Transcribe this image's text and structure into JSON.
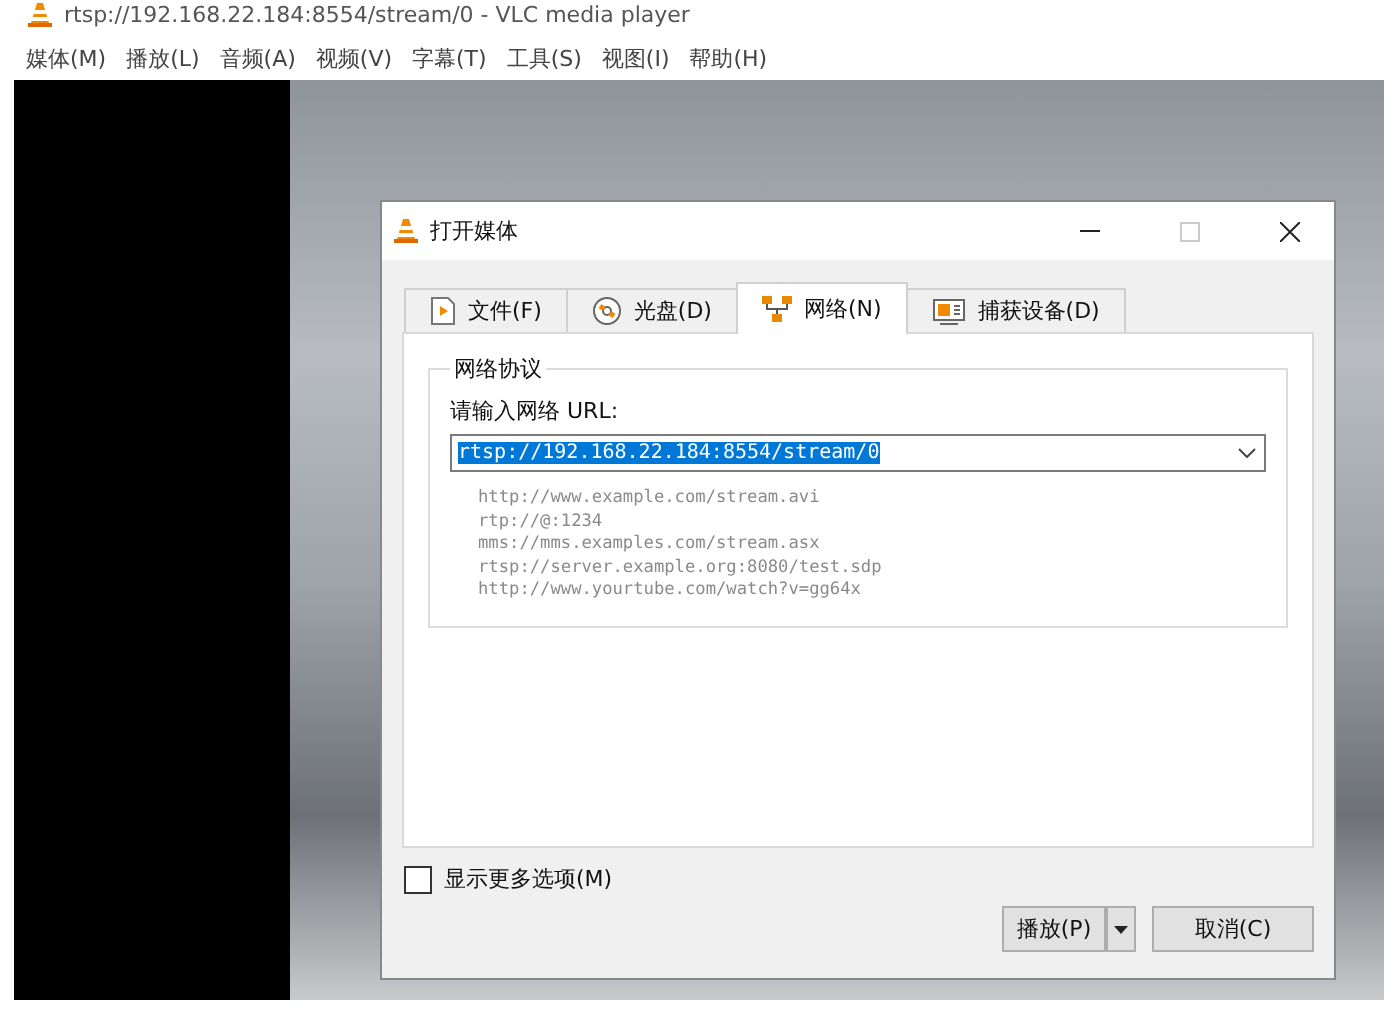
{
  "window": {
    "title": "rtsp://192.168.22.184:8554/stream/0 - VLC media player"
  },
  "menu": [
    "媒体(M)",
    "播放(L)",
    "音频(A)",
    "视频(V)",
    "字幕(T)",
    "工具(S)",
    "视图(I)",
    "帮助(H)"
  ],
  "dialog": {
    "title": "打开媒体",
    "tabs": [
      {
        "label": "文件(F)",
        "kind": "file",
        "selected": false
      },
      {
        "label": "光盘(D)",
        "kind": "disc",
        "selected": false
      },
      {
        "label": "网络(N)",
        "kind": "network",
        "selected": true
      },
      {
        "label": "捕获设备(D)",
        "kind": "capture",
        "selected": false
      }
    ],
    "group_title": "网络协议",
    "url_label": "请输入网络 URL:",
    "url_value": "rtsp://192.168.22.184:8554/stream/0",
    "examples": [
      "http://www.example.com/stream.avi",
      "rtp://@:1234",
      "mms://mms.examples.com/stream.asx",
      "rtsp://server.example.org:8080/test.sdp",
      "http://www.yourtube.com/watch?v=gg64x"
    ],
    "more_options": {
      "label": "显示更多选项(M)",
      "checked": false
    },
    "play_button": "播放(P)",
    "cancel_button": "取消(C)"
  }
}
